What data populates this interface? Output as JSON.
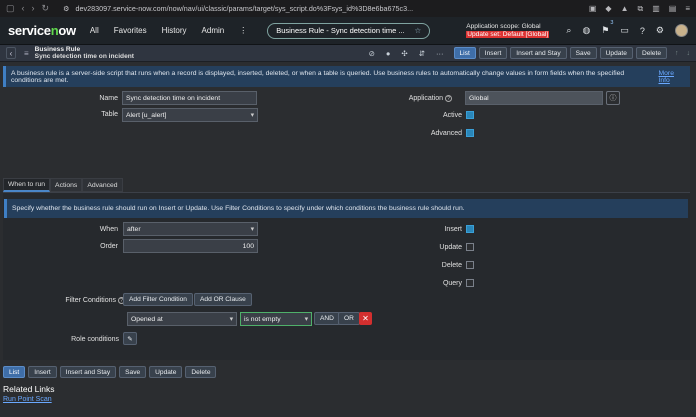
{
  "browser": {
    "url": "dev283097.service-now.com/now/nav/ui/classic/params/target/sys_script.do%3Fsys_id%3D8e6ba675c3..."
  },
  "header": {
    "logo": "servicenow",
    "menu": [
      "All",
      "Favorites",
      "History",
      "Admin"
    ],
    "pill_title": "Business Rule - Sync detection time ...",
    "scope_line1": "Application scope: Global",
    "scope_line2": "Update set: Default [Global]",
    "badge": "3"
  },
  "form": {
    "heading": "Business Rule",
    "record_name": "Sync detection time on incident",
    "buttons": [
      "List",
      "Insert",
      "Insert and Stay",
      "Save",
      "Update",
      "Delete"
    ]
  },
  "info": {
    "text": "A business rule is a server-side script that runs when a record is displayed, inserted, deleted, or when a table is queried. Use business rules to automatically change values in form fields when the specified conditions are met.",
    "link": "More Info"
  },
  "fields": {
    "name_label": "Name",
    "name_value": "Sync detection time on incident",
    "table_label": "Table",
    "table_value": "Alert [u_alert]",
    "application_label": "Application",
    "application_value": "Global",
    "active_label": "Active",
    "advanced_label": "Advanced"
  },
  "tabs": [
    "When to run",
    "Actions",
    "Advanced"
  ],
  "when": {
    "info": "Specify whether the business rule should run on Insert or Update. Use Filter Conditions to specify under which conditions the business rule should run.",
    "when_label": "When",
    "when_value": "after",
    "order_label": "Order",
    "order_value": "100",
    "insert_label": "Insert",
    "update_label": "Update",
    "delete_label": "Delete",
    "query_label": "Query",
    "filter_label": "Filter Conditions",
    "add_filter": "Add Filter Condition",
    "add_or": "Add OR Clause",
    "cond_field": "Opened at",
    "cond_op": "is not empty",
    "and_btn": "AND",
    "or_btn": "OR",
    "role_label": "Role conditions"
  },
  "bottom_buttons": [
    "List",
    "Insert",
    "Insert and Stay",
    "Save",
    "Update",
    "Delete"
  ],
  "related": {
    "title": "Related Links",
    "link": "Run Point Scan"
  }
}
